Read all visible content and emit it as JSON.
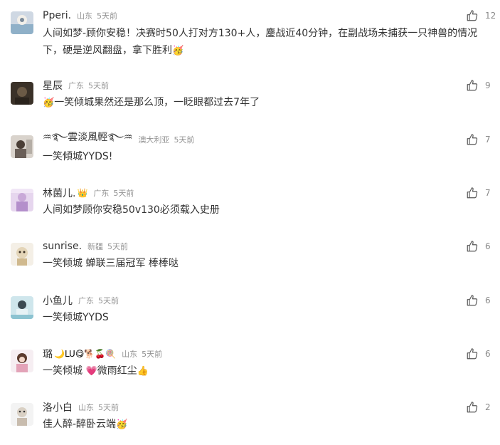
{
  "comments": [
    {
      "name": "Pperi.",
      "deco": "",
      "location": "山东",
      "time": "5天前",
      "text": "人间如梦-顾你安稳！决赛时50人打对方130+人，鏖战近40分钟，在副战场未捕获一只神兽的情况下，硬是逆风翻盘，拿下胜利",
      "emoji_end": "🥳",
      "likes": "12"
    },
    {
      "name": "星辰",
      "deco": "",
      "location": "广东",
      "time": "5天前",
      "emoji_start": "🥳",
      "text": "一笑倾城果然还是那么顶，一眨眼都过去7年了",
      "likes": "9"
    },
    {
      "name": "♒࿐雲淡風輕࿐♒",
      "deco": "",
      "location": "澳大利亚",
      "time": "5天前",
      "text": "一笑傾城YYDS!",
      "likes": "7"
    },
    {
      "name": "林菌儿.",
      "deco": "👑",
      "location": "广东",
      "time": "5天前",
      "text": "人间如梦顾你安稳50v130必须载入史册",
      "likes": "7"
    },
    {
      "name": "sunrise.",
      "deco": "",
      "location": "新疆",
      "time": "5天前",
      "text": "一笑倾城 蝉联三届冠军 棒棒哒",
      "likes": "6"
    },
    {
      "name": "小鱼儿",
      "deco": "",
      "location": "广东",
      "time": "5天前",
      "text": "一笑倾城YYDS",
      "likes": "6"
    },
    {
      "name": "璐",
      "deco": "🌙LU😋🐕🍒🍭",
      "location": "山东",
      "time": "5天前",
      "text": "一笑倾城 ",
      "emoji_mid": "💗",
      "text2": "微雨红尘",
      "emoji_end": "👍",
      "likes": "6"
    },
    {
      "name": "洛小白",
      "deco": "",
      "location": "山东",
      "time": "5天前",
      "text": "佳人醉-醉卧云端",
      "emoji_end": "🥳",
      "likes": "2"
    }
  ]
}
